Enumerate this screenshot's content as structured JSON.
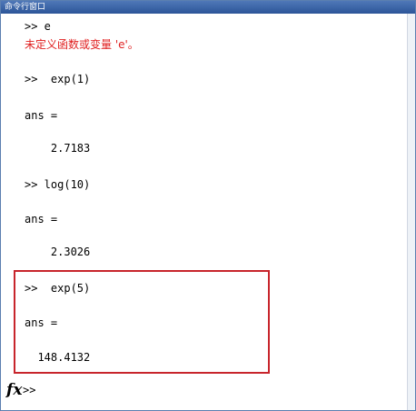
{
  "window": {
    "title": "命令行窗口"
  },
  "console": {
    "lines": [
      {
        "text": ">> e",
        "kind": "input"
      },
      {
        "text": "未定义函数或变量 'e'。",
        "kind": "error"
      },
      {
        "text": ">>  exp(1)",
        "kind": "input"
      },
      {
        "text": "ans =",
        "kind": "output"
      },
      {
        "text": "    2.7183",
        "kind": "output"
      },
      {
        "text": ">> log(10)",
        "kind": "input"
      },
      {
        "text": "ans =",
        "kind": "output"
      },
      {
        "text": "    2.3026",
        "kind": "output"
      },
      {
        "text": ">>  exp(5)",
        "kind": "input"
      },
      {
        "text": "ans =",
        "kind": "output"
      },
      {
        "text": "  148.4132",
        "kind": "output"
      }
    ],
    "prompt": ">>",
    "fx_symbol": "fx"
  },
  "colors": {
    "highlight": "#c8252c",
    "error_text": "#e02020",
    "titlebar": "#2c5598"
  }
}
